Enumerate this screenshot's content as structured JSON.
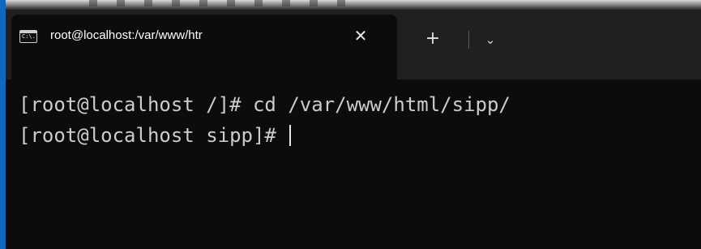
{
  "tab": {
    "icon_text": "C:\\.",
    "title": "root@localhost:/var/www/htr",
    "close": "✕"
  },
  "toolbar": {
    "new_tab": "+",
    "dropdown": "⌄"
  },
  "terminal": {
    "lines": [
      "[root@localhost /]# cd /var/www/html/sipp/",
      "[root@localhost sipp]# "
    ]
  },
  "colors": {
    "background": "#0c0c0c",
    "titlebar": "#202020",
    "text": "#cccccc",
    "accent_edge": "#0f67c1"
  }
}
